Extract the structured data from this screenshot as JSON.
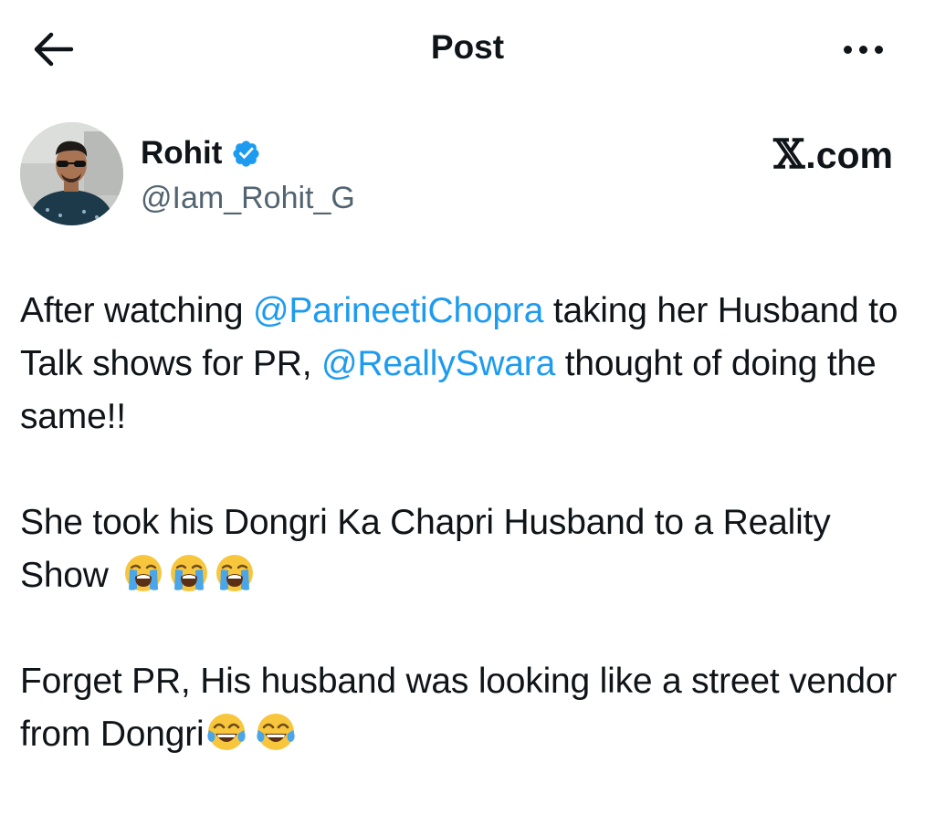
{
  "header": {
    "title": "Post",
    "back_icon": "arrow-left-icon",
    "more_icon": "more-horizontal-icon"
  },
  "author": {
    "name": "Rohit",
    "handle": "@Iam_Rohit_G",
    "verified_icon": "verified-badge-icon",
    "verified_color": "#1d9bf0"
  },
  "source": {
    "x_mark": "𝕏",
    "domain": ".com"
  },
  "tweet": {
    "p1": {
      "t1": "After watching ",
      "mention1": "@ParineetiChopra",
      "t2": " taking her Husband to Talk shows for PR, ",
      "mention2": "@ReallySwara",
      "t3": " thought of doing the same!!"
    },
    "p2": {
      "text": "She took his Dongri Ka Chapri Husband to a Reality Show",
      "emoji": "loudly-crying-face"
    },
    "p3": {
      "text": "Forget PR, His husband was looking like a street vendor from Dongri",
      "emoji": "face-with-tears-of-joy"
    }
  },
  "colors": {
    "mention": "#1d9bf0",
    "text": "#0f1419",
    "secondary": "#536471"
  }
}
